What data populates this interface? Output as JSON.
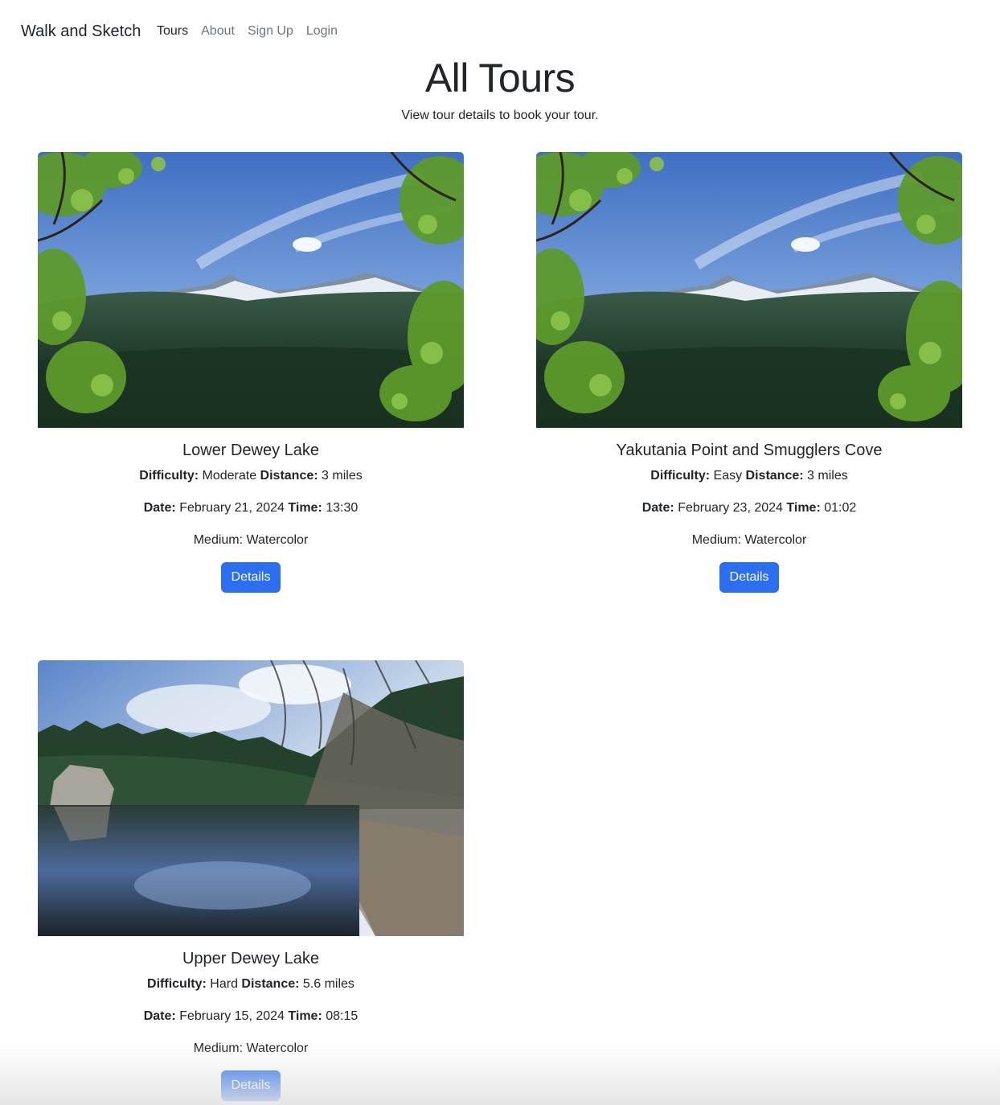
{
  "nav": {
    "brand": "Walk and Sketch",
    "links": [
      "Tours",
      "About",
      "Sign Up",
      "Login"
    ]
  },
  "header": {
    "title": "All Tours",
    "subtitle": "View tour details to book your tour."
  },
  "labels": {
    "difficulty": "Difficulty:",
    "distance": "Distance:",
    "date": "Date:",
    "time": "Time:",
    "details": "Details"
  },
  "tours": [
    {
      "name": "Lower Dewey Lake",
      "difficulty": "Moderate",
      "distance": "3 miles",
      "date": "February 21, 2024",
      "time": "13:30",
      "medium": "Medium: Watercolor"
    },
    {
      "name": "Yakutania Point and Smugglers Cove",
      "difficulty": "Easy",
      "distance": "3 miles",
      "date": "February 23, 2024",
      "time": "01:02",
      "medium": "Medium: Watercolor"
    },
    {
      "name": "Upper Dewey Lake",
      "difficulty": "Hard",
      "distance": "5.6 miles",
      "date": "February 15, 2024",
      "time": "08:15",
      "medium": "Medium: Watercolor"
    }
  ]
}
